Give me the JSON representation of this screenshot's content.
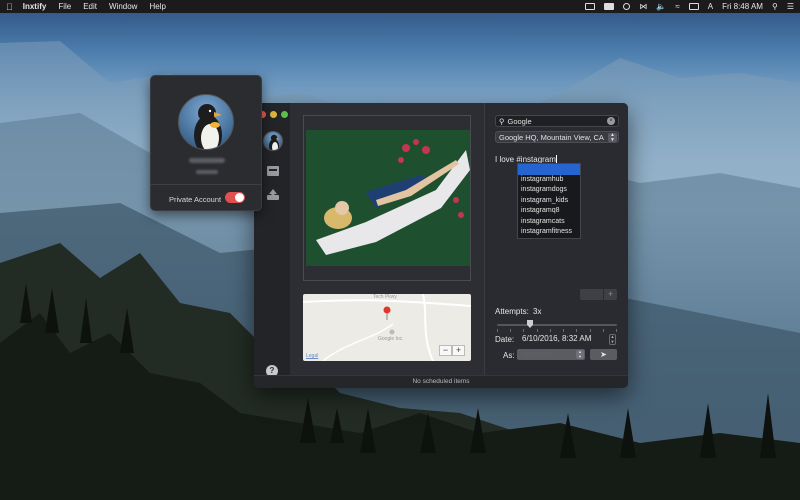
{
  "menubar": {
    "app_name": "Inxtify",
    "items": [
      "File",
      "Edit",
      "Window",
      "Help"
    ],
    "clock": "Fri 8:48 AM",
    "input_source": "A"
  },
  "popover": {
    "private_label": "Private Account",
    "private_enabled": true
  },
  "post": {
    "location_search": "Google",
    "location_selected": "Google HQ, Mountain View, CA",
    "caption": "I love #instagram",
    "hashtag_suggestions": [
      "instagram",
      "instagramhub",
      "instagramdogs",
      "instagram_kids",
      "instagramq8",
      "instagramcats",
      "instagramfitness"
    ],
    "selected_suggestion_index": 0,
    "attempts_label": "Attempts:",
    "attempts_value": "3x",
    "date_label": "Date:",
    "date_value": "6/10/2016,  8:32 AM",
    "as_label": "As:"
  },
  "map": {
    "place_label": "Google Inc.",
    "road_label": "Tech Pkwy",
    "legal": "Legal",
    "zoom_out": "−",
    "zoom_in": "+"
  },
  "status": {
    "text": "No scheduled items"
  },
  "help": {
    "label": "?"
  },
  "colors": {
    "toggle_on": "#e15050",
    "suggestion_highlight": "#2565d0",
    "window_bg": "#2a2b30"
  }
}
